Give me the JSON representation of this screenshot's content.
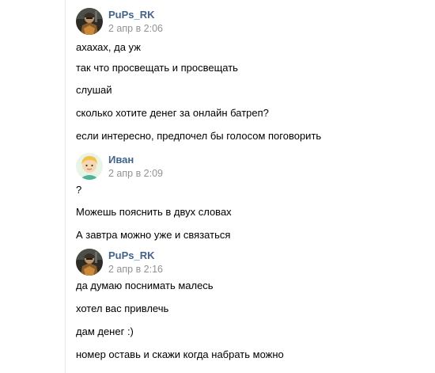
{
  "messages": [
    {
      "author": "PuPs_RK",
      "time": "2 апр в 2:06",
      "avatar_icon": "warrior-avatar-icon",
      "lines": [
        "ахахах, да уж",
        "так что просвещать и просвещать",
        "слушай",
        "сколько хотите денег за онлайн батреп?",
        "если интересно, предпочел бы голосом поговорить"
      ]
    },
    {
      "author": "Иван",
      "time": "2 апр в 2:09",
      "avatar_icon": "cartoon-person-avatar-icon",
      "lines": [
        "?",
        "Можешь пояснить в двух словах",
        "А завтра можно уже и связаться"
      ]
    },
    {
      "author": "PuPs_RK",
      "time": "2 апр в 2:16",
      "avatar_icon": "warrior-avatar-icon",
      "lines": [
        "да думаю поснимать малесь",
        "хотел вас привлечь",
        "дам денег :)",
        "номер оставь и скажи когда набрать можно"
      ]
    }
  ],
  "colors": {
    "author": "#42648b",
    "time": "#939393",
    "text": "#000000",
    "border": "#e7e8ec"
  }
}
